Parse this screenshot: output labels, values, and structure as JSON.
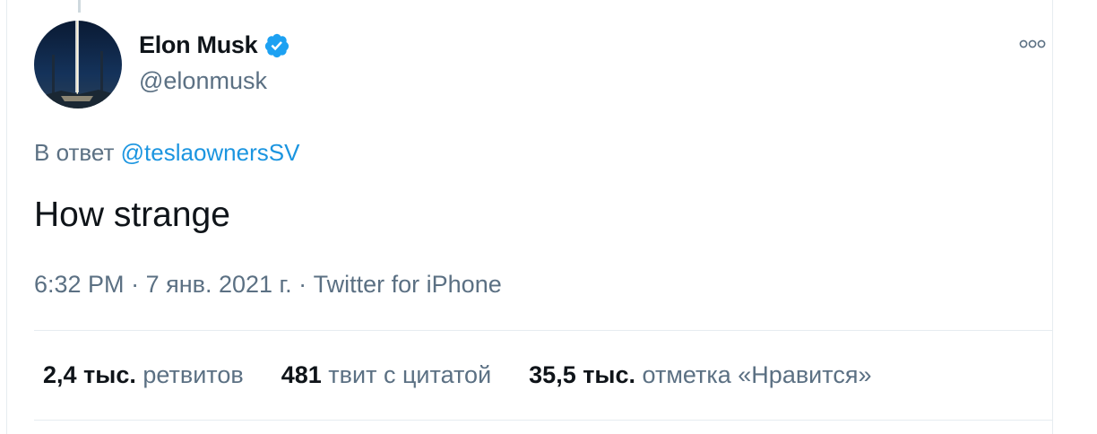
{
  "tweet": {
    "author": {
      "name": "Elon Musk",
      "handle": "@elonmusk",
      "verified": true
    },
    "reply": {
      "prefix": "В ответ",
      "mention": "@teslaownersSV"
    },
    "text": "How strange",
    "meta": {
      "time": "6:32 PM",
      "date": "7 янв. 2021 г.",
      "source": "Twitter for iPhone",
      "separator": "·"
    },
    "stats": {
      "retweets": {
        "count": "2,4 тыс.",
        "label": "ретвитов"
      },
      "quotes": {
        "count": "481",
        "label": "твит с цитатой"
      },
      "likes": {
        "count": "35,5 тыс.",
        "label": "отметка «Нравится»"
      }
    }
  },
  "icons": {
    "verified": "verified-badge-icon",
    "more": "more-options-icon"
  },
  "colors": {
    "accent": "#1da1f2",
    "link": "#1b95e0",
    "secondary_text": "#5b7083",
    "primary_text": "#0f1419",
    "divider": "#e6ecf0"
  }
}
